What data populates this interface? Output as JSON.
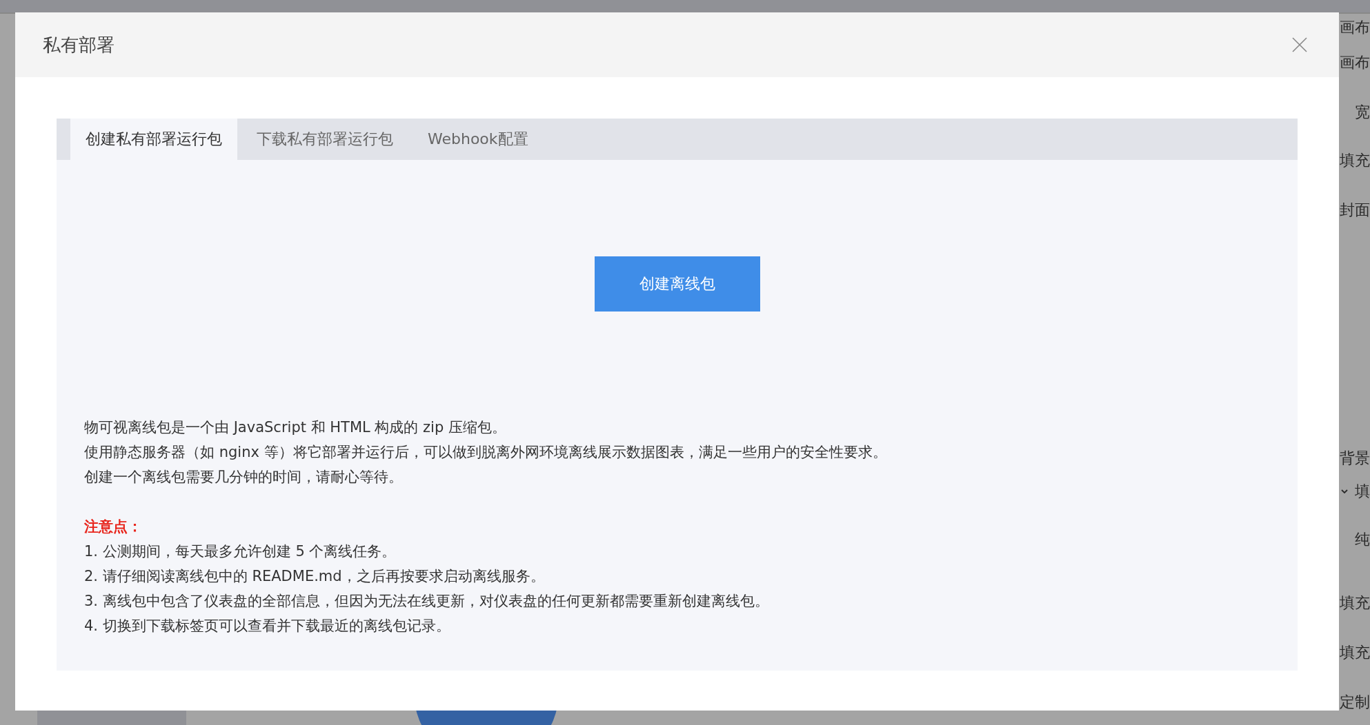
{
  "background_panel": {
    "labels": [
      "画布",
      "画布",
      "宽",
      "填充",
      "封面",
      "背景",
      "填",
      "纯",
      "填充",
      "填充",
      "定制"
    ]
  },
  "dialog": {
    "title": "私有部署",
    "tabs": [
      {
        "label": "创建私有部署运行包",
        "selected": true
      },
      {
        "label": "下载私有部署运行包",
        "selected": false
      },
      {
        "label": "Webhook配置",
        "selected": false
      }
    ],
    "create_button": "创建离线包",
    "description": [
      "物可视离线包是一个由 JavaScript 和 HTML 构成的 zip 压缩包。",
      "使用静态服务器（如 nginx 等）将它部署并运行后，可以做到脱离外网环境离线展示数据图表，满足一些用户的安全性要求。",
      "创建一个离线包需要几分钟的时间，请耐心等待。"
    ],
    "notes_heading": "注意点：",
    "notes": [
      "1. 公测期间，每天最多允许创建 5 个离线任务。",
      "2. 请仔细阅读离线包中的 README.md，之后再按要求启动离线服务。",
      "3. 离线包中包含了仪表盘的全部信息，但因为无法在线更新，对仪表盘的任何更新都需要重新创建离线包。",
      "4. 切换到下载标签页可以查看并下载最近的离线包记录。"
    ]
  }
}
